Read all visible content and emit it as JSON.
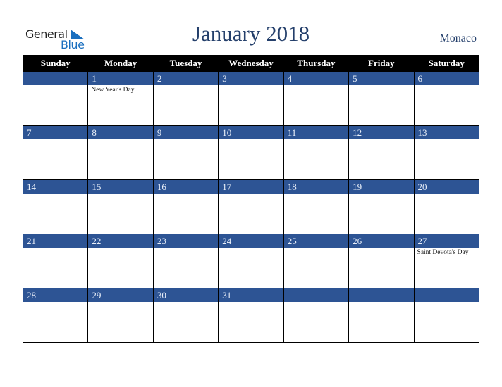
{
  "logo": {
    "line1": "General",
    "line2": "Blue",
    "icon": "triangle-flag-icon"
  },
  "title": "January 2018",
  "country": "Monaco",
  "colors": {
    "header_bg": "#000000",
    "day_bar": "#2d5494",
    "title": "#243f6b",
    "logo_blue": "#1a6fbf"
  },
  "weekdays": [
    "Sunday",
    "Monday",
    "Tuesday",
    "Wednesday",
    "Thursday",
    "Friday",
    "Saturday"
  ],
  "weeks": [
    [
      {
        "day": "",
        "event": ""
      },
      {
        "day": "1",
        "event": "New Year's Day"
      },
      {
        "day": "2",
        "event": ""
      },
      {
        "day": "3",
        "event": ""
      },
      {
        "day": "4",
        "event": ""
      },
      {
        "day": "5",
        "event": ""
      },
      {
        "day": "6",
        "event": ""
      }
    ],
    [
      {
        "day": "7",
        "event": ""
      },
      {
        "day": "8",
        "event": ""
      },
      {
        "day": "9",
        "event": ""
      },
      {
        "day": "10",
        "event": ""
      },
      {
        "day": "11",
        "event": ""
      },
      {
        "day": "12",
        "event": ""
      },
      {
        "day": "13",
        "event": ""
      }
    ],
    [
      {
        "day": "14",
        "event": ""
      },
      {
        "day": "15",
        "event": ""
      },
      {
        "day": "16",
        "event": ""
      },
      {
        "day": "17",
        "event": ""
      },
      {
        "day": "18",
        "event": ""
      },
      {
        "day": "19",
        "event": ""
      },
      {
        "day": "20",
        "event": ""
      }
    ],
    [
      {
        "day": "21",
        "event": ""
      },
      {
        "day": "22",
        "event": ""
      },
      {
        "day": "23",
        "event": ""
      },
      {
        "day": "24",
        "event": ""
      },
      {
        "day": "25",
        "event": ""
      },
      {
        "day": "26",
        "event": ""
      },
      {
        "day": "27",
        "event": "Saint Devota's Day"
      }
    ],
    [
      {
        "day": "28",
        "event": ""
      },
      {
        "day": "29",
        "event": ""
      },
      {
        "day": "30",
        "event": ""
      },
      {
        "day": "31",
        "event": ""
      },
      {
        "day": "",
        "event": ""
      },
      {
        "day": "",
        "event": ""
      },
      {
        "day": "",
        "event": ""
      }
    ]
  ]
}
